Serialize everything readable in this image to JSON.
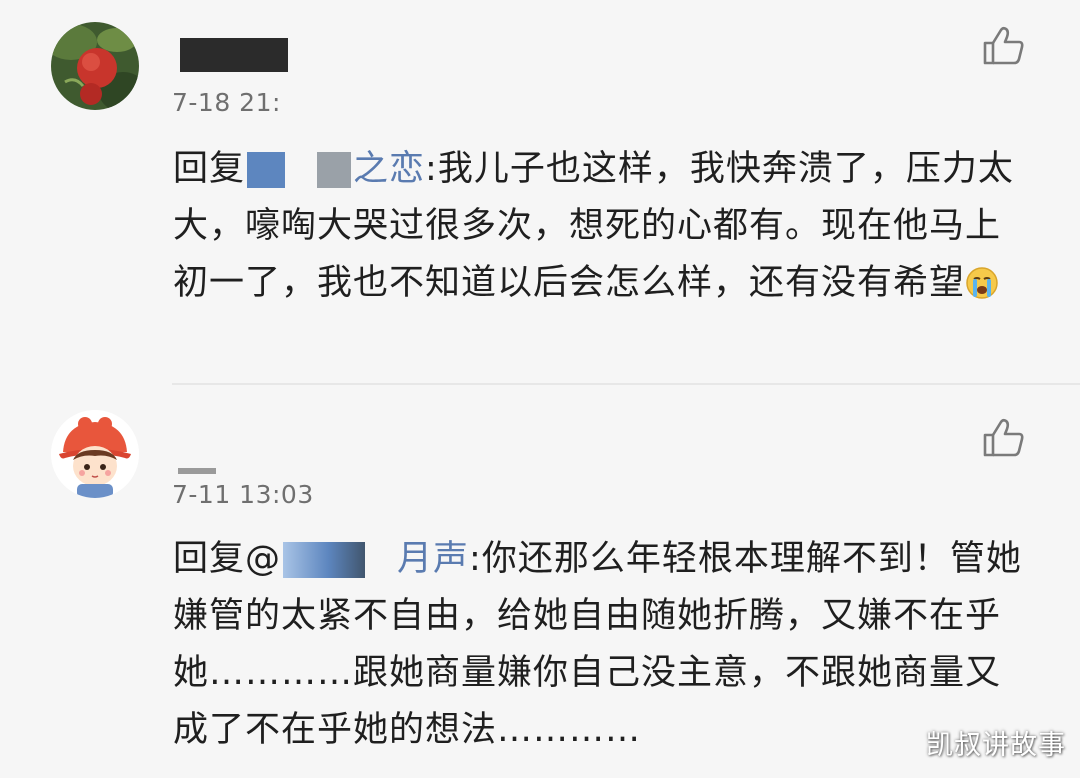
{
  "comments": [
    {
      "time": "7-18 21:",
      "reply_prefix": "回复",
      "mention_tail": "之恋",
      "text": ":我儿子也这样，我快奔溃了，压力太大，嚎啕大哭过很多次，想死的心都有。现在他马上初一了，我也不知道以后会怎么样，还有没有希望",
      "emoji": "crying-face"
    },
    {
      "time": "7-11 13:03",
      "reply_prefix": "回复@",
      "mention_tail": "月声",
      "text": ":你还那么年轻根本理解不到！管她嫌管的太紧不自由，给她自由随她折腾，又嫌不在乎她…………跟她商量嫌你自己没主意，不跟她商量又成了不在乎她的想法…………"
    }
  ],
  "watermark": "凯叔讲故事",
  "colors": {
    "background": "#f6f6f6",
    "mention": "#5a7bb0",
    "time": "#6f6f6f"
  }
}
